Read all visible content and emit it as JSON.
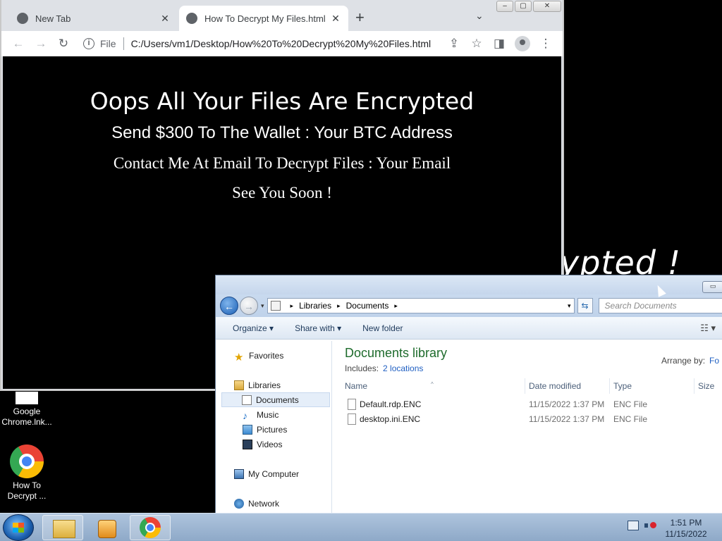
{
  "desktop": {
    "wallpaper_text": "ypted !",
    "icons": [
      {
        "label": "Google Chrome.lnk..."
      },
      {
        "label": "How To Decrypt ..."
      }
    ]
  },
  "browser": {
    "tabs": [
      {
        "title": "New Tab",
        "close": "✕"
      },
      {
        "title": "How To Decrypt My Files.html",
        "close": "✕"
      }
    ],
    "new_tab": "+",
    "tab_search": "⌄",
    "controls": {
      "minimize": "–",
      "maximize": "▢",
      "close": "✕"
    },
    "toolbar": {
      "back": "←",
      "forward": "→",
      "reload": "↻",
      "info": "i",
      "scheme_label": "File",
      "url": "C:/Users/vm1/Desktop/How%20To%20Decrypt%20My%20Files.html",
      "share": "⇪",
      "star": "☆",
      "sidepanel": "◨",
      "menu": "⋮"
    },
    "page": {
      "heading": "Oops All Your Files Are Encrypted",
      "wallet_line": "Send $300 To The Wallet : Your BTC Address",
      "contact_line": "Contact Me At Email To Decrypt Files : Your Email",
      "farewell": "See You Soon !"
    }
  },
  "explorer": {
    "minimize": "▭",
    "nav": {
      "back": "←",
      "forward": "→",
      "history_dropdown": "▾"
    },
    "address": {
      "separator": "▸",
      "crumbs": [
        "Libraries",
        "Documents"
      ],
      "dropdown": "▾",
      "refresh": "⇆"
    },
    "search_placeholder": "Search Documents",
    "commands": [
      {
        "label": "Organize ▾"
      },
      {
        "label": "Share with ▾"
      },
      {
        "label": "New folder"
      }
    ],
    "view_icon": "☷ ▾",
    "navpane": {
      "favorites": "Favorites",
      "libraries": "Libraries",
      "documents": "Documents",
      "music": "Music",
      "pictures": "Pictures",
      "videos": "Videos",
      "computer": "My Computer",
      "network": "Network"
    },
    "library": {
      "title": "Documents library",
      "includes_label": "Includes:",
      "includes_link": "2 locations",
      "arrange_label": "Arrange by:",
      "arrange_value": "Fo"
    },
    "columns": [
      "Name",
      "Date modified",
      "Type",
      "Size"
    ],
    "sort_indicator": "^",
    "files": [
      {
        "name": "Default.rdp.ENC",
        "modified": "11/15/2022 1:37 PM",
        "type": "ENC File"
      },
      {
        "name": "desktop.ini.ENC",
        "modified": "11/15/2022 1:37 PM",
        "type": "ENC File"
      }
    ]
  },
  "taskbar": {
    "clock_time": "1:51 PM",
    "clock_date": "11/15/2022"
  }
}
